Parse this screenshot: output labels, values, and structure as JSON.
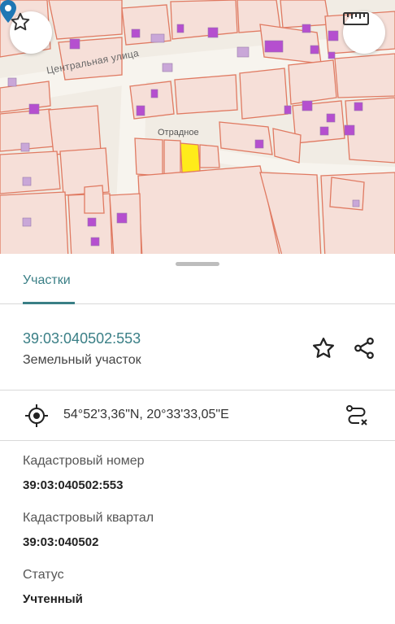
{
  "map": {
    "street_label": "Центральная улица",
    "place_label": "Отрадное",
    "favorite_icon": "star-outline-icon",
    "ruler_icon": "ruler-icon",
    "pin_icon": "map-pin-icon",
    "colors": {
      "background": "#f1ece4",
      "parcel_line": "#e07a62",
      "parcel_fill": "#f6dfd8",
      "building": "#c9a7d8",
      "building_accent": "#b54fcf",
      "selected": "#ffeb1a",
      "pin": "#1f77b4"
    }
  },
  "tabs": [
    {
      "label": "Участки",
      "active": true
    }
  ],
  "parcel": {
    "cadastral_id": "39:03:040502:553",
    "type": "Земельный участок",
    "favorite_icon": "star-outline-icon",
    "share_icon": "share-icon"
  },
  "coordinates": {
    "text": "54°52'3,36\"N, 20°33'33,05\"E",
    "locate_icon": "crosshair-icon",
    "route_icon": "route-icon"
  },
  "details": [
    {
      "label": "Кадастровый номер",
      "value": "39:03:040502:553"
    },
    {
      "label": "Кадастровый квартал",
      "value": "39:03:040502"
    },
    {
      "label": "Статус",
      "value": "Учтенный"
    }
  ],
  "accent_color": "#3a7f86"
}
